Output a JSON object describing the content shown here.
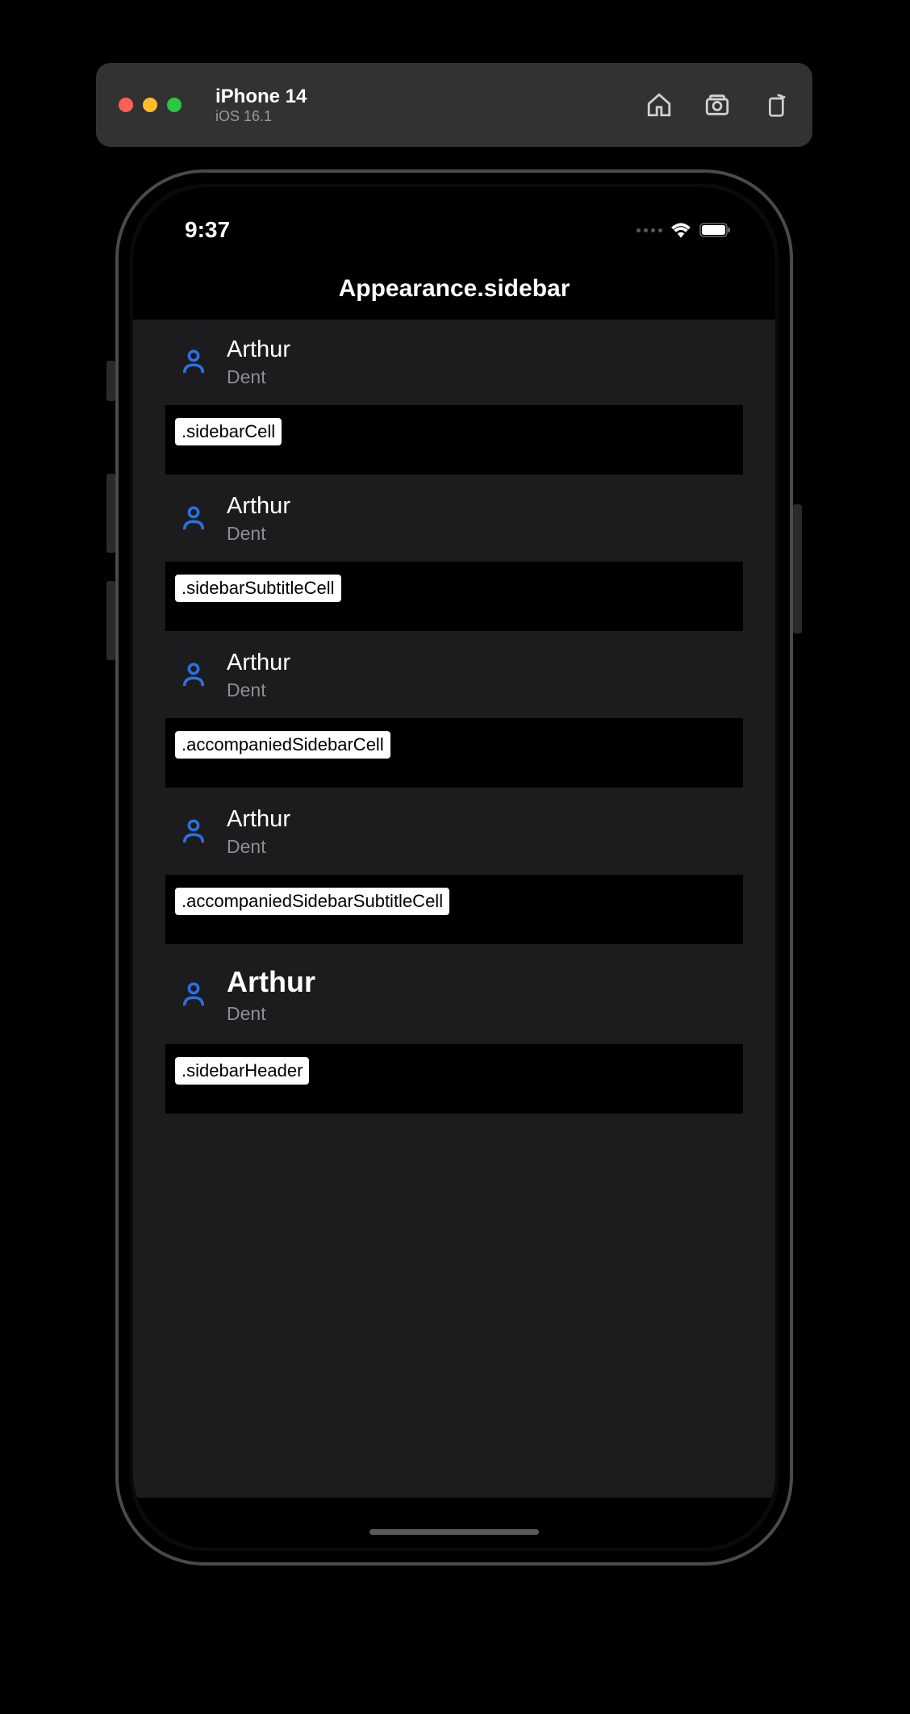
{
  "simulator": {
    "device_name": "iPhone 14",
    "os_version": "iOS 16.1",
    "icons": {
      "home": "home-icon",
      "screenshot": "camera-icon",
      "rotate": "rotate-icon"
    }
  },
  "status_bar": {
    "time": "9:37"
  },
  "nav": {
    "title": "Appearance.sidebar"
  },
  "cells": [
    {
      "title": "Arthur",
      "subtitle": "Dent",
      "label": ".sidebarCell",
      "variant": "normal"
    },
    {
      "title": "Arthur",
      "subtitle": "Dent",
      "label": ".sidebarSubtitleCell",
      "variant": "normal"
    },
    {
      "title": "Arthur",
      "subtitle": "Dent",
      "label": ".accompaniedSidebarCell",
      "variant": "normal"
    },
    {
      "title": "Arthur",
      "subtitle": "Dent",
      "label": ".accompaniedSidebarSubtitleCell",
      "variant": "normal"
    },
    {
      "title": "Arthur",
      "subtitle": "Dent",
      "label": ".sidebarHeader",
      "variant": "header"
    }
  ],
  "colors": {
    "accent": "#2c70e4",
    "background": "#000000",
    "content_bg": "#1c1c1e",
    "secondary_text": "#8e8e93"
  }
}
